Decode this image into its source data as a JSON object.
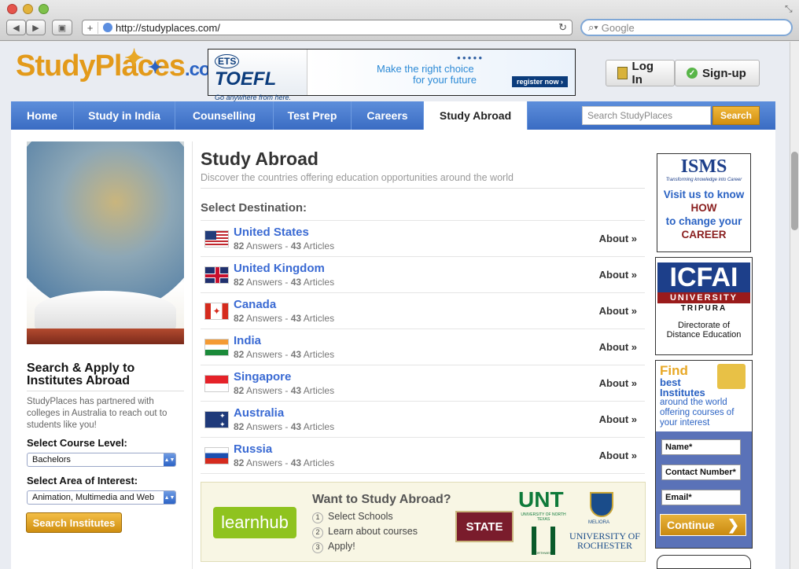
{
  "browser": {
    "url": "http://studyplaces.com/",
    "search_placeholder": "Google"
  },
  "logo": {
    "part1": "StudyPlaces",
    "part2": ".com"
  },
  "banner": {
    "ets": "ETS",
    "toefl": "TOEFL",
    "tag": "Go anywhere from here.",
    "line1": "Make the right choice",
    "line2": "for your future",
    "cta": "register now ›"
  },
  "auth": {
    "login": "Log In",
    "signup": "Sign-up"
  },
  "nav": {
    "tabs": [
      "Home",
      "Study in India",
      "Counselling",
      "Test Prep",
      "Careers",
      "Study Abroad"
    ],
    "search_placeholder": "Search StudyPlaces",
    "search_button": "Search"
  },
  "sidebar": {
    "heading": "Search & Apply to Institutes Abroad",
    "blurb": "StudyPlaces has partnered with colleges in Australia to reach out to students like you!",
    "course_label": "Select Course Level:",
    "course_value": "Bachelors",
    "area_label": "Select Area of Interest:",
    "area_value": "Animation, Multimedia and Web",
    "button": "Search Institutes"
  },
  "main": {
    "title": "Study Abroad",
    "subtitle": "Discover the countries offering education opportunities around the world",
    "select_label": "Select Destination:",
    "about_label": "About »",
    "countries": [
      {
        "name": "United States",
        "answers": "82",
        "answers_label": "Answers",
        "articles": "43",
        "articles_label": "Articles"
      },
      {
        "name": "United Kingdom",
        "answers": "82",
        "answers_label": "Answers",
        "articles": "43",
        "articles_label": "Articles"
      },
      {
        "name": "Canada",
        "answers": "82",
        "answers_label": "Answers",
        "articles": "43",
        "articles_label": "Articles"
      },
      {
        "name": "India",
        "answers": "82",
        "answers_label": "Answers",
        "articles": "43",
        "articles_label": "Articles"
      },
      {
        "name": "Singapore",
        "answers": "82",
        "answers_label": "Answers",
        "articles": "43",
        "articles_label": "Articles"
      },
      {
        "name": "Australia",
        "answers": "82",
        "answers_label": "Answers",
        "articles": "43",
        "articles_label": "Articles"
      },
      {
        "name": "Russia",
        "answers": "82",
        "answers_label": "Answers",
        "articles": "43",
        "articles_label": "Articles"
      }
    ]
  },
  "promo": {
    "brand": "learnhub",
    "title": "Want to Study Abroad?",
    "steps": [
      "Select Schools",
      "Learn about courses",
      "Apply!"
    ],
    "logos": [
      "STATE",
      "UNT",
      "UNIVERSITY OF NORTH TEXAS",
      "MELIORA",
      "UNIVERSITY OF ROCHESTER",
      "NORTHWEST"
    ]
  },
  "ads": {
    "isms": {
      "logo": "ISMS",
      "tag": "Transforming knowledge into Career",
      "l1": "Visit us to know",
      "l2": "HOW",
      "l3": "to change your",
      "l4": "CAREER"
    },
    "icfai": {
      "logo": "ICFAI",
      "uni": "UNIVERSITY",
      "loc": "TRIPURA",
      "desc": "Directorate of Distance Education"
    },
    "find": {
      "l1": "Find",
      "l2": "best",
      "l3": "Institutes",
      "l4": "around the world offering courses of your interest",
      "fields": [
        "Name*",
        "Contact Number*",
        "Email*"
      ],
      "button": "Continue"
    }
  },
  "colors": {
    "nav_blue": "#4a7dd2",
    "link_blue": "#3a6ad3",
    "orange": "#e8a826",
    "promo_green": "#8fc31f"
  }
}
